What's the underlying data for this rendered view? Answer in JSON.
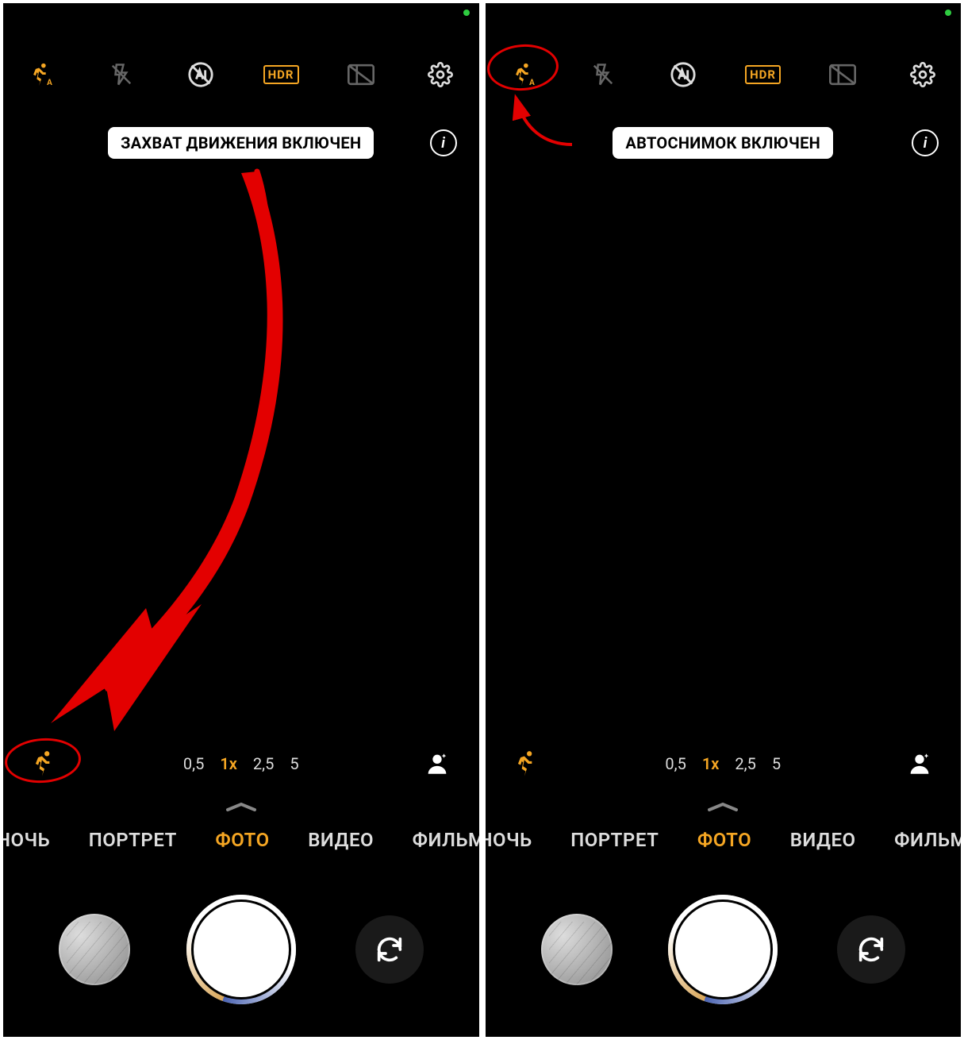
{
  "screens": {
    "left": {
      "toolbar": {
        "motion_auto_state": "active",
        "hdr_label": "HDR"
      },
      "toast": "ЗАХВАТ ДВИЖЕНИЯ ВКЛЮЧЕН",
      "zoom": {
        "options": [
          "0,5",
          "1x",
          "2,5",
          "5"
        ],
        "active_index": 1
      },
      "modes": [
        "НОЧЬ",
        "ПОРТРЕТ",
        "ФОТО",
        "ВИДЕО",
        "ФИЛЬМ"
      ],
      "active_mode_index": 2,
      "annotation": {
        "large_arrow": true,
        "circle_bottom_motion": true
      }
    },
    "right": {
      "toolbar": {
        "motion_auto_state": "active",
        "hdr_label": "HDR"
      },
      "toast": "АВТОСНИМОК ВКЛЮЧЕН",
      "zoom": {
        "options": [
          "0,5",
          "1x",
          "2,5",
          "5"
        ],
        "active_index": 1
      },
      "modes": [
        "НОЧЬ",
        "ПОРТРЕТ",
        "ФОТО",
        "ВИДЕО",
        "ФИЛЬМ"
      ],
      "active_mode_index": 2,
      "annotation": {
        "circle_top_motion": true,
        "curved_arrow_to_circle": true
      }
    }
  },
  "colors": {
    "accent": "#f5a623",
    "annotation": "#e30000"
  }
}
